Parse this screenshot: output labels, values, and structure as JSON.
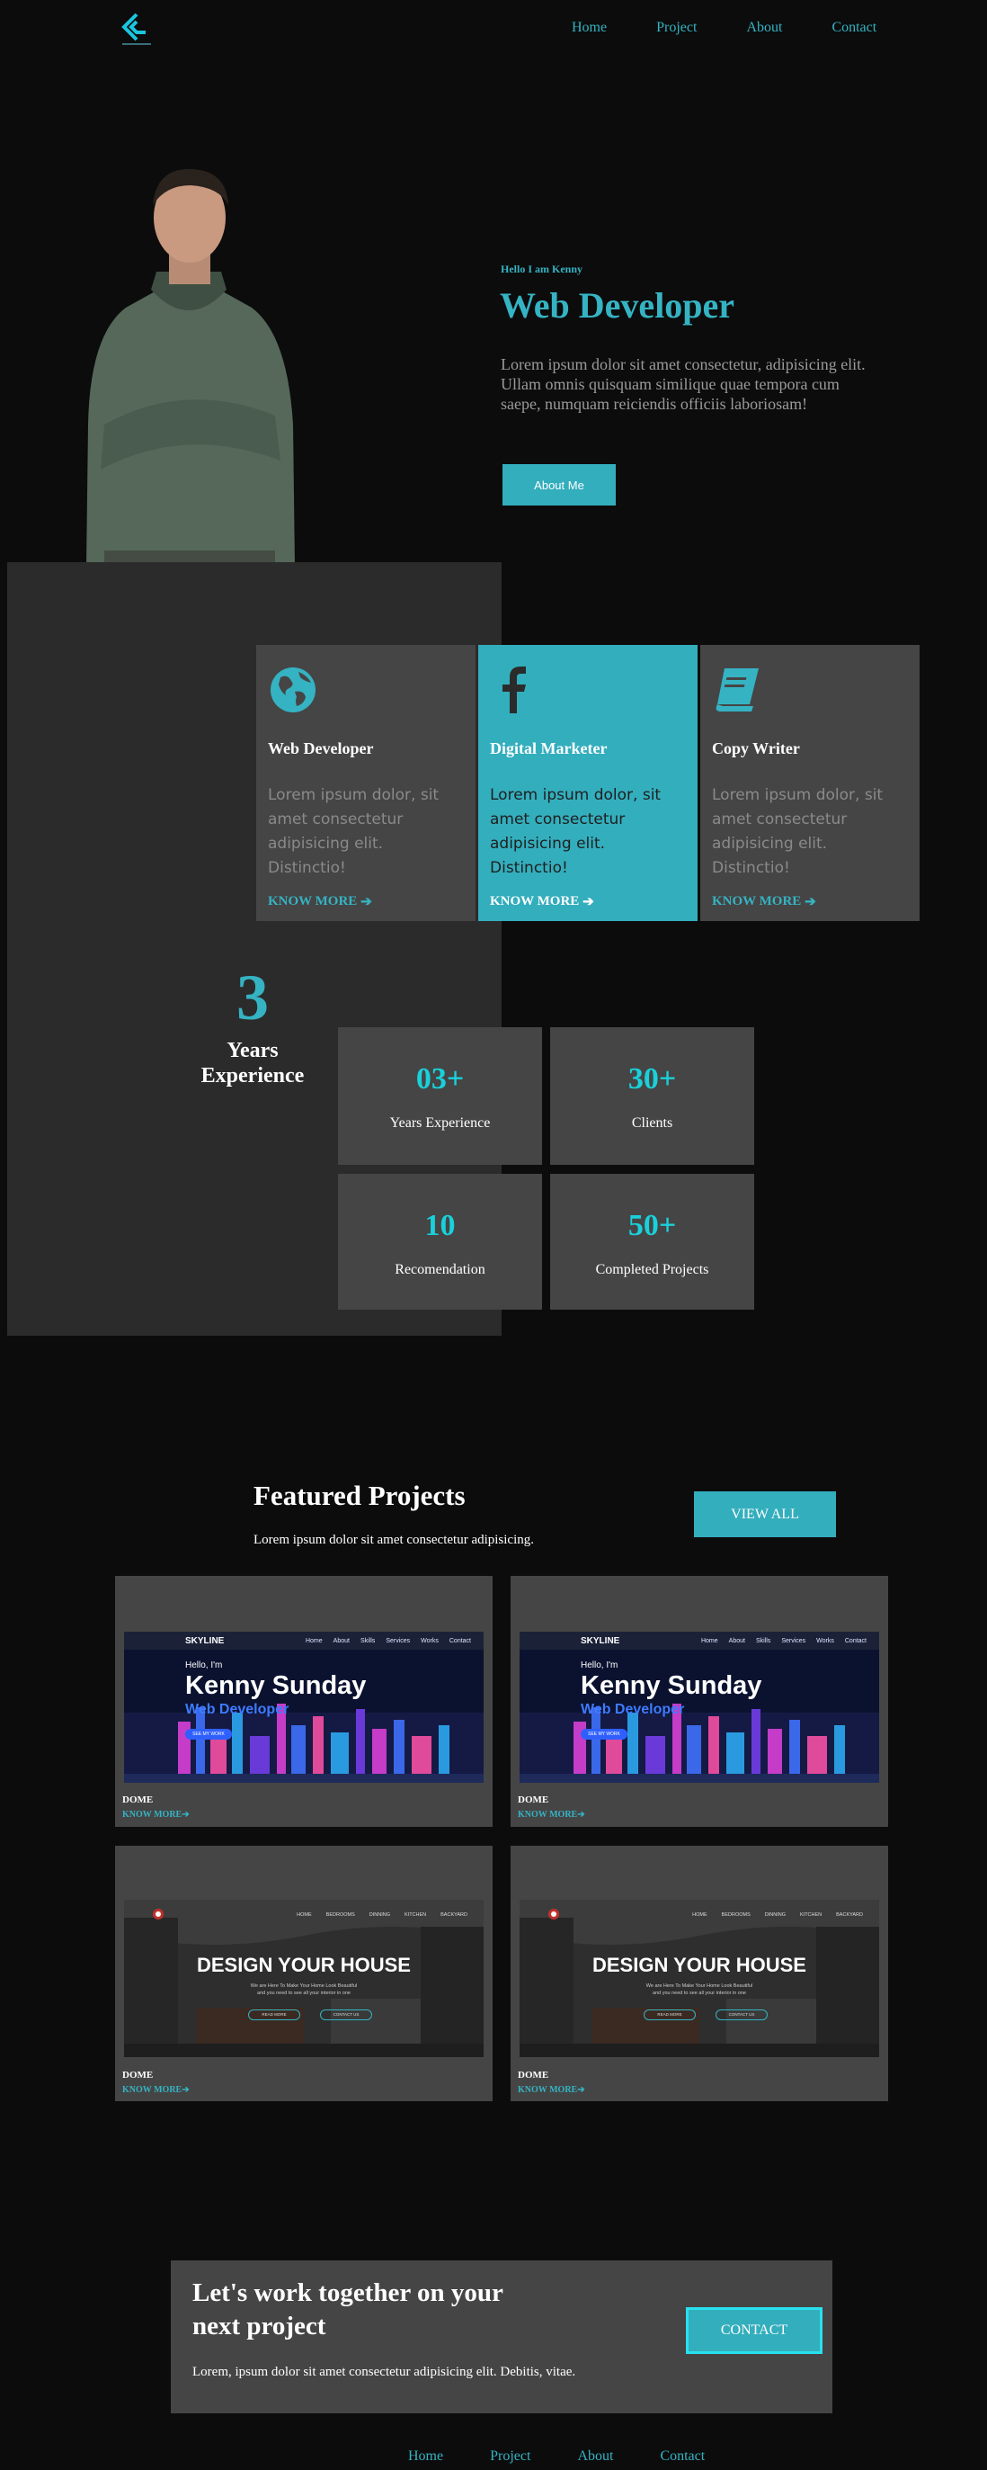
{
  "nav": {
    "items": [
      "Home",
      "Project",
      "About",
      "Contact"
    ]
  },
  "hero": {
    "greeting": "Hello I am Kenny",
    "title": "Web Developer",
    "text": "Lorem ipsum dolor sit amet consectetur, adipisicing elit. Ullam omnis quisquam similique quae tempora cum saepe, numquam reiciendis officiis laboriosam!",
    "button": "About Me"
  },
  "services": [
    {
      "icon": "globe-icon",
      "title": "Web Developer",
      "text": "Lorem ipsum dolor, sit amet consectetur adipisicing elit. Distinctio!",
      "more": "KNOW MORE"
    },
    {
      "icon": "facebook-icon",
      "title": "Digital Marketer",
      "text": "Lorem ipsum dolor, sit amet consectetur adipisicing elit. Distinctio!",
      "more": "KNOW MORE"
    },
    {
      "icon": "book-icon",
      "title": "Copy Writer",
      "text": "Lorem ipsum dolor, sit amet consectetur adipisicing elit. Distinctio!",
      "more": "KNOW MORE"
    }
  ],
  "experience": {
    "number": "3",
    "label": "Years Experience"
  },
  "stats": [
    {
      "value": "03+",
      "label": "Years Experience"
    },
    {
      "value": "30+",
      "label": "Clients"
    },
    {
      "value": "10",
      "label": "Recomendation"
    },
    {
      "value": "50+",
      "label": "Completed Projects"
    }
  ],
  "projects": {
    "title": "Featured Projects",
    "subtitle": "Lorem ipsum dolor sit amet consectetur adipisicing.",
    "view_all": "VIEW ALL",
    "skyline": {
      "brand": "SKYLINE",
      "links": [
        "Home",
        "About",
        "Skills",
        "Services",
        "Works",
        "Contact"
      ],
      "hello": "Hello, I'm",
      "name": "Kenny Sunday",
      "role": "Web Developer",
      "button": "SEE MY WORK"
    },
    "house": {
      "links": [
        "HOME",
        "BEDROOMS",
        "DINNING",
        "KITCHEN",
        "BACKYARD"
      ],
      "title": "DESIGN YOUR HOUSE",
      "tag1": "We are Here To Make Your Home Look Beautiful",
      "tag2": "and you need to see all your interior in one",
      "btn1": "READ MORE",
      "btn2": "CONTACT US"
    },
    "cards": [
      {
        "name": "DOME",
        "more": "KNOW MORE"
      },
      {
        "name": "DOME",
        "more": "KNOW MORE"
      },
      {
        "name": "DOME",
        "more": "KNOW MORE"
      },
      {
        "name": "DOME",
        "more": "KNOW MORE"
      }
    ]
  },
  "cta": {
    "title": "Let's work together on your next project",
    "text": "Lorem, ipsum dolor sit amet consectetur adipisicing elit. Debitis, vitae.",
    "button": "CONTACT"
  },
  "footer": {
    "items": [
      "Home",
      "Project",
      "About",
      "Contact"
    ]
  },
  "colors": {
    "accent": "#33aebd",
    "stat_number": "#19d1db",
    "background": "#0c0c0c",
    "card": "#454545",
    "panel": "#2b2b2b"
  }
}
